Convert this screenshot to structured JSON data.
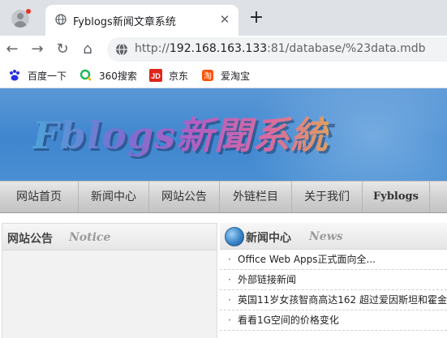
{
  "browser": {
    "tab": {
      "title": "Fyblogs新闻文章系统",
      "close_glyph": "✕"
    },
    "newtab_glyph": "+",
    "nav": {
      "back": "←",
      "forward": "→",
      "reload": "↻",
      "home": "⌂"
    },
    "omnibox": {
      "scheme": "http://",
      "host": "192.168.163.133",
      "rest": ":81/database/%23data.mdb"
    },
    "bookmarks": [
      {
        "label": "百度一下",
        "icon": "baidu-paw-icon",
        "color": "#2932e1"
      },
      {
        "label": "360搜索",
        "icon": "360-search-icon",
        "color": "#19b955"
      },
      {
        "label": "京东",
        "icon": "jd-icon",
        "color": "#e1251b"
      },
      {
        "label": "爱淘宝",
        "icon": "taobao-icon",
        "color": "#ff5000"
      }
    ]
  },
  "site": {
    "logo_text": "Fblogs新聞系統",
    "menu": [
      "网站首页",
      "新闻中心",
      "网站公告",
      "外链栏目",
      "关于我们",
      "Fyblogs"
    ],
    "notice_panel": {
      "title": "网站公告",
      "subtitle": "Notice"
    },
    "news_panel": {
      "title": "新闻中心",
      "subtitle": "News",
      "items": [
        "Office  Web  Apps正式面向全...",
        "外部链接新闻",
        "英国11岁女孩智商高达162  超过爱因斯坦和霍金",
        "看看1G空间的价格变化"
      ]
    }
  },
  "colors": {
    "banner_blue": "#4a8fd3",
    "menu_gray": "#d2d2d2"
  }
}
